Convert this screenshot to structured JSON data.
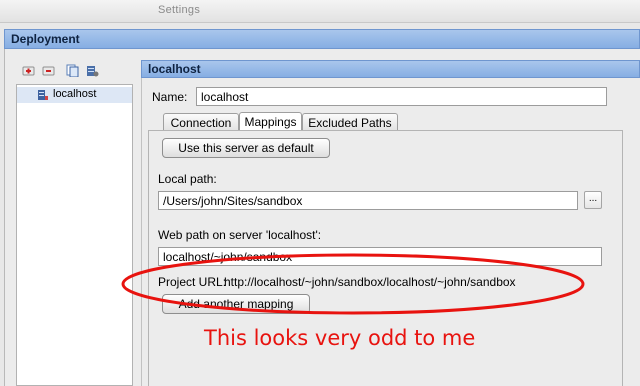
{
  "window": {
    "title": "Settings"
  },
  "deployment": {
    "title": "Deployment"
  },
  "toolbar": {
    "icons": [
      "add-server-icon",
      "remove-server-icon",
      "copy-server-icon",
      "server-settings-icon"
    ]
  },
  "servers": [
    {
      "name": "localhost",
      "icon": "server-icon"
    }
  ],
  "detail": {
    "header": "localhost",
    "name_label": "Name:",
    "name_value": "localhost",
    "tabs": [
      {
        "label": "Connection",
        "active": false
      },
      {
        "label": "Mappings",
        "active": true
      },
      {
        "label": "Excluded Paths",
        "active": false
      }
    ],
    "default_button": "Use this server as default",
    "local_path_label": "Local path:",
    "local_path_value": "/Users/john/Sites/sandbox",
    "browse_label": "...",
    "web_path_label": "Web path on server 'localhost':",
    "web_path_value": "localhost/~john/sandbox",
    "project_url_label": "Project URL:",
    "project_url_value": "http://localhost/~john/sandbox/localhost/~john/sandbox",
    "add_mapping_button": "Add another mapping"
  },
  "annotation": {
    "text": "This looks very odd to me",
    "color": "#e8130f"
  }
}
